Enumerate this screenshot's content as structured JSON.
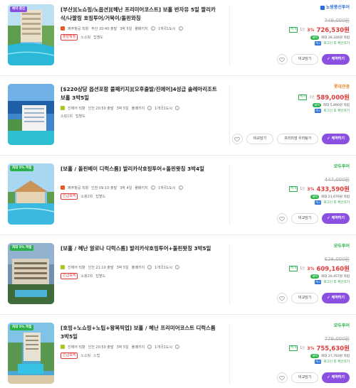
{
  "products": [
    {
      "badge": "예약 증진",
      "title": "[부산][노쇼핑/노옵션][헤난 프리미어코스트] 보홀 반자유 5일 팔리카삭/나팔링 호핑투어/거북이/돌핀와칭",
      "supplier": "제주항공 직항",
      "schedule": "부산 20:40 출발",
      "duration": "3박 5일",
      "package_type": "풀패키지",
      "room": "1개국1도시",
      "tags": [
        "출발확정",
        "노쇼핑",
        "팁별도"
      ],
      "brand": "노랑풍선투어",
      "brand_color": "#2b6fd6",
      "original_price": "749,000원",
      "discount": "3%",
      "price": "726,530원",
      "benefit": "최대 36,326원 적립",
      "cashback": "로그인 후 확인하기"
    },
    {
      "badge": "",
      "title": "[$220상당 옵션포함 풀패키지][오후출발/진에어]4성급 솔레아리조트 보홀 3박5일",
      "supplier": "진에어 직항",
      "schedule": "인천 20:50 출발",
      "duration": "3박 5일",
      "package_type": "풀패키지",
      "room": "1개국1도시",
      "tags": [
        "쇼핑1회",
        "팁별도"
      ],
      "brand": "롯데관광",
      "brand_color": "#e68a2e",
      "original_price": "",
      "discount": "",
      "price": "589,000원",
      "benefit": "최대 5,890원 적립",
      "cashback": "로그인 후 확인하기",
      "extra_button": "프리미엄 우리팀가"
    },
    {
      "badge": "최대 5% 적립",
      "title": "[보홀 / 돌핀베이 디럭스룸] 발리카삭호핑투어+돌핀왓칭 3박4일",
      "supplier": "제주항공 직항",
      "schedule": "인천 09:10 출발",
      "duration": "3박 4일",
      "package_type": "풀패키지",
      "room": "1개국1도시",
      "tags": [
        "긴급모객",
        "쇼핑2회",
        "팁별도"
      ],
      "brand": "모두투어",
      "brand_color": "#2bb04a",
      "original_price": "447,000원",
      "discount": "3%",
      "price": "433,590원",
      "benefit": "최대 21,679원 적립",
      "cashback": "로그인 후 확인하기"
    },
    {
      "badge": "최대 5% 적립",
      "title": "[보홀 / 헤난 알로나 디럭스룸] 발리카삭호핑투어+돌핀왓칭 3박5일",
      "supplier": "진에어 직항",
      "schedule": "인천 21:10 출발",
      "duration": "3박 5일",
      "package_type": "풀패키지",
      "room": "1개국1도시",
      "tags": [
        "긴급모객",
        "쇼핑2회",
        "팁별도"
      ],
      "brand": "모두투어",
      "brand_color": "#2bb04a",
      "original_price": "628,000원",
      "discount": "3%",
      "price": "609,160원",
      "benefit": "최대 30,457원 적립",
      "cashback": "로그인 후 확인하기"
    },
    {
      "badge": "최대 5% 적립",
      "title": "[호핑+노쇼핑+노팁+왕복픽업] 보홀 / 헤난 프리미어코스트 디럭스룸 3박5일",
      "supplier": "진에어 직항",
      "schedule": "인천 20:50 출발",
      "duration": "3박 5일",
      "package_type": "풀패키지",
      "room": "1개국1도시",
      "tags": [
        "긴급모객",
        "노쇼핑",
        "노팁"
      ],
      "brand": "모두투어",
      "brand_color": "#2bb04a",
      "original_price": "779,000원",
      "discount": "3%",
      "price": "755,630원",
      "benefit": "최대 37,783원 적립",
      "cashback": "로그인 후 확인하기"
    }
  ],
  "common": {
    "compare_label": "비교담기",
    "reserve_label": "예약하기",
    "per_person": "1인",
    "benefit_tag": "혜택",
    "cashback_tag": "캐시"
  },
  "colors": {
    "accent": "#8a4fe0",
    "sale": "#e03a3a",
    "green": "#27a84a"
  }
}
